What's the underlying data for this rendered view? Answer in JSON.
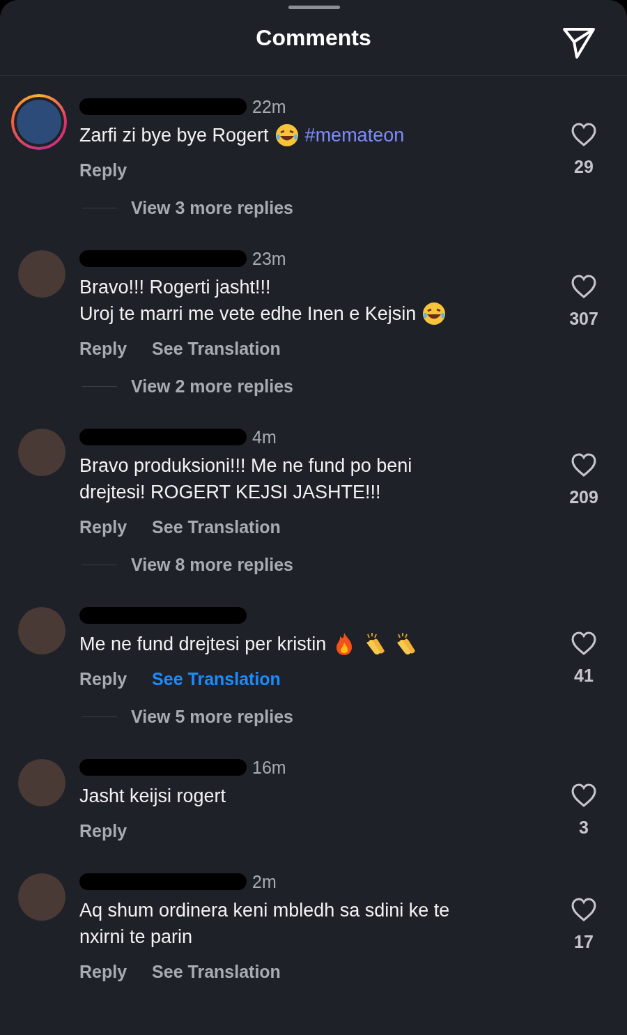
{
  "header": {
    "title": "Comments"
  },
  "comments": [
    {
      "story_ring": true,
      "time": "22m",
      "lines": [
        [
          {
            "kind": "text",
            "text": "Zarfi zi bye bye Rogert"
          },
          {
            "kind": "laugh"
          },
          {
            "kind": "tag",
            "text": "#memateon"
          }
        ]
      ],
      "reply": "Reply",
      "likes": "29",
      "replies": "View 3 more replies"
    },
    {
      "story_ring": false,
      "time": "23m",
      "lines": [
        [
          {
            "kind": "text",
            "text": "Bravo!!! Rogerti jasht!!!"
          }
        ],
        [
          {
            "kind": "text",
            "text": "Uroj te marri me vete edhe Inen e Kejsin"
          },
          {
            "kind": "laugh"
          }
        ]
      ],
      "reply": "Reply",
      "translation": {
        "label": "See Translation",
        "active": false
      },
      "likes": "307",
      "replies": "View 2 more replies"
    },
    {
      "story_ring": false,
      "time": "4m",
      "lines": [
        [
          {
            "kind": "text",
            "text": "Bravo produksioni!!! Me ne fund po beni"
          }
        ],
        [
          {
            "kind": "text",
            "text": "drejtesi! ROGERT KEJSI JASHTE!!!"
          }
        ]
      ],
      "reply": "Reply",
      "translation": {
        "label": "See Translation",
        "active": false
      },
      "likes": "209",
      "replies": "View 8 more replies"
    },
    {
      "story_ring": false,
      "lines": [
        [
          {
            "kind": "text",
            "text": "Me ne fund drejtesi per kristin"
          },
          {
            "kind": "fire"
          },
          {
            "kind": "clap"
          },
          {
            "kind": "clap"
          }
        ]
      ],
      "reply": "Reply",
      "translation": {
        "label": "See Translation",
        "active": true
      },
      "likes": "41",
      "replies": "View 5 more replies"
    },
    {
      "story_ring": false,
      "time": "16m",
      "lines": [
        [
          {
            "kind": "text",
            "text": "Jasht keijsi rogert"
          }
        ]
      ],
      "reply": "Reply",
      "likes": "3"
    },
    {
      "story_ring": false,
      "time": "2m",
      "lines": [
        [
          {
            "kind": "text",
            "text": "Aq shum ordinera keni mbledh sa sdini ke te"
          }
        ],
        [
          {
            "kind": "text",
            "text": "nxirni te parin"
          }
        ]
      ],
      "reply": "Reply",
      "translation": {
        "label": "See Translation",
        "active": false
      },
      "likes": "17"
    }
  ]
}
